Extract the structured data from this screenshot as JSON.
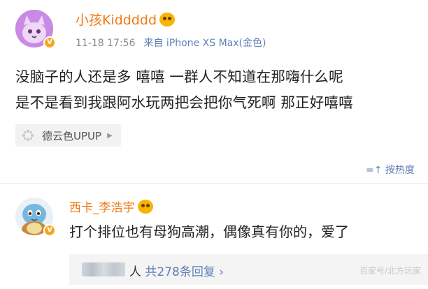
{
  "post": {
    "username": "小孩Kiddddd",
    "verified_badge": "V",
    "time": "11-18 17:56",
    "source": "来自 iPhone XS Max(金色)",
    "text_line1": "没脑子的人还是多 嘻嘻 一群人不知道在那嗨什么呢",
    "text_line2": "是不是看到我跟阿水玩两把会把你气死啊 那正好嘻嘻",
    "topic": "德云色UPUP"
  },
  "sort_label": "按热度",
  "comment": {
    "username": "西卡_李浩宇",
    "text": "打个排位也有母狗高潮，偶像真有你的，爱了",
    "verified_badge": "V"
  },
  "replies": {
    "suffix": "人",
    "count_label": "共278条回复",
    "chevron": "›",
    "watermark": "百家号/北方玩家"
  },
  "colors": {
    "username": "#f07a16",
    "link": "#5f7fb8",
    "meta": "#8a8a8a",
    "badge": "#f6a623"
  },
  "icons": [
    "avatar-purple-cat",
    "vip-emoji-badge",
    "topic-pinwheel-icon",
    "sort-icon",
    "squirtle-avatar",
    "chevron-right-icon"
  ]
}
